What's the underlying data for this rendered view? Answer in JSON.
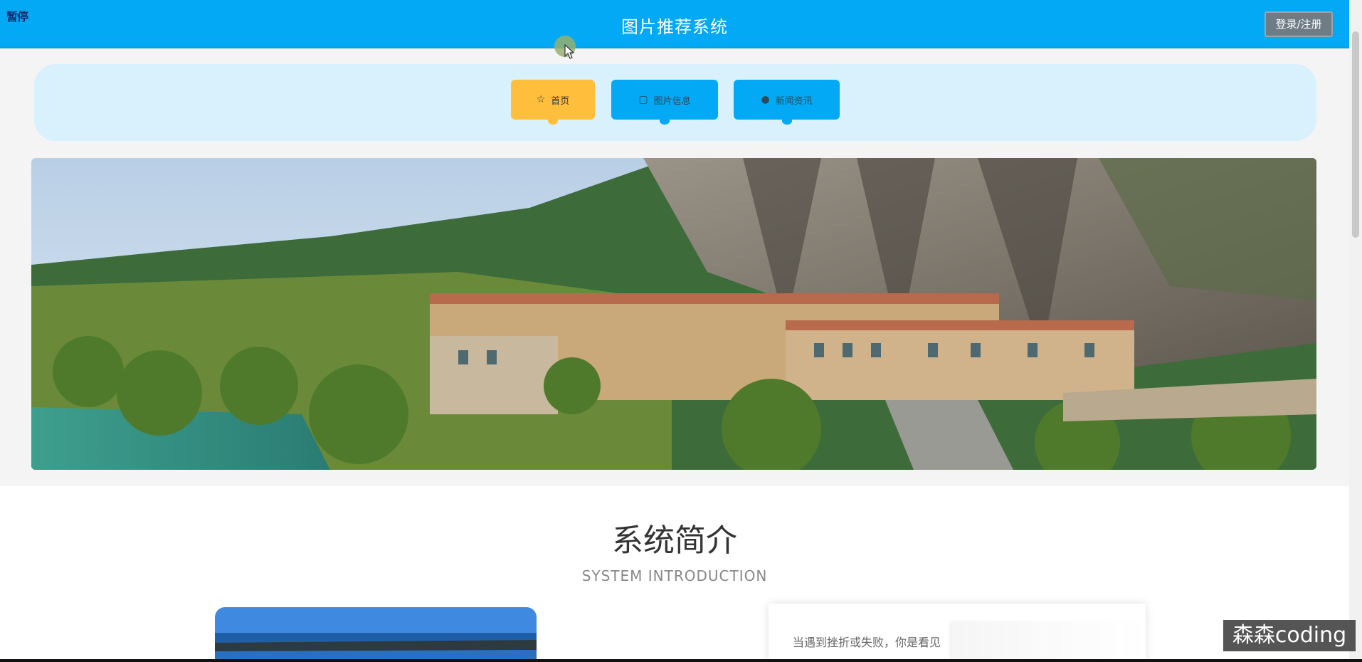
{
  "player": {
    "pause_label": "暂停"
  },
  "header": {
    "title": "图片推荐系统",
    "login_label": "登录/注册"
  },
  "nav": {
    "items": [
      {
        "label": "首页",
        "icon": "star-outline-icon"
      },
      {
        "label": "图片信息",
        "icon": "image-icon"
      },
      {
        "label": "新闻资讯",
        "icon": "news-icon"
      }
    ]
  },
  "intro": {
    "title": "系统简介",
    "subtitle": "SYSTEM INTRODUCTION",
    "text": "当遇到挫折或失败，你是看见"
  },
  "watermark": {
    "text": "森森coding"
  },
  "colors": {
    "primary": "#03a9f4",
    "accent": "#ffbe3b",
    "nav_bg": "#d9f0fd"
  }
}
